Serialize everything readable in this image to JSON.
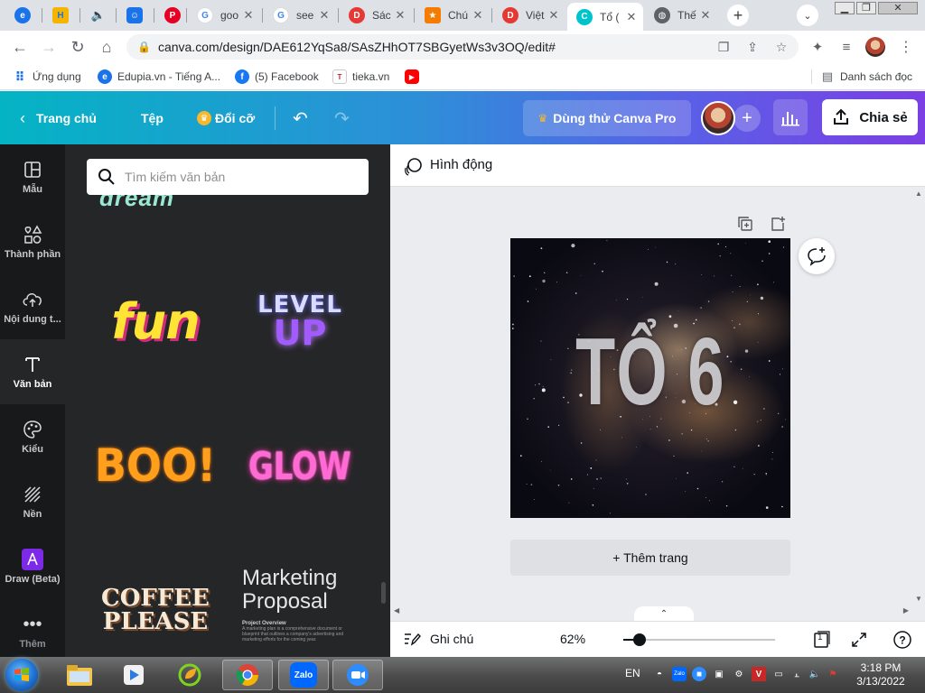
{
  "browser": {
    "tabs": [
      {
        "title": "",
        "favicon": "edupia-icon",
        "color": "#1a73e8"
      },
      {
        "title": "",
        "favicon": "yellow-h-icon",
        "color": "#f4b400"
      },
      {
        "title": "",
        "favicon": "speaker-icon",
        "color": "#5f6368"
      },
      {
        "title": "",
        "favicon": "bot-icon",
        "color": "#1a73e8"
      },
      {
        "title": "",
        "favicon": "pinterest-icon",
        "color": "#e60023"
      },
      {
        "title": "goo",
        "favicon": "google-icon",
        "color": "#4285f4"
      },
      {
        "title": "see",
        "favicon": "google-icon",
        "color": "#4285f4"
      },
      {
        "title": "Sác",
        "favicon": "d-logo-icon",
        "color": "#e53935"
      },
      {
        "title": "Chú",
        "favicon": "brand-icon",
        "color": "#f57c00"
      },
      {
        "title": "Việt",
        "favicon": "d-logo-icon",
        "color": "#e53935"
      },
      {
        "title": "Tổ (",
        "favicon": "canva-icon",
        "color": "#00c4cc"
      },
      {
        "title": "Thế",
        "favicon": "globe-icon",
        "color": "#5f6368"
      }
    ],
    "url": "canva.com/design/DAE612YqSa8/SAsZHhOT7SBGyetWs3v3OQ/edit#",
    "bookmarks": [
      {
        "label": "Ứng dụng",
        "icon": "apps-grid-icon"
      },
      {
        "label": "Edupia.vn - Tiếng A...",
        "icon": "edupia-icon"
      },
      {
        "label": "(5) Facebook",
        "icon": "facebook-icon"
      },
      {
        "label": "tieka.vn",
        "icon": "tieka-icon"
      },
      {
        "label": "",
        "icon": "youtube-icon"
      }
    ],
    "reading_list": "Danh sách đọc"
  },
  "canva_header": {
    "home": "Trang chủ",
    "file": "Tệp",
    "resize": "Đổi cỡ",
    "try_pro": "Dùng thử Canva Pro",
    "share": "Chia sẻ"
  },
  "rail": [
    {
      "label": "Mẫu",
      "icon": "template-icon"
    },
    {
      "label": "Thành phần",
      "icon": "elements-icon"
    },
    {
      "label": "Nội dung t...",
      "icon": "upload-cloud-icon"
    },
    {
      "label": "Văn bản",
      "icon": "text-icon",
      "active": true
    },
    {
      "label": "Kiểu",
      "icon": "palette-icon"
    },
    {
      "label": "Nền",
      "icon": "background-icon"
    },
    {
      "label": "Draw (Beta)",
      "icon": "draw-icon"
    },
    {
      "label": "Thêm",
      "icon": "more-dots-icon"
    }
  ],
  "panel": {
    "search_placeholder": "Tìm kiếm văn bản",
    "text_styles": [
      {
        "text": "fun",
        "name": "fun-text-style"
      },
      {
        "text": "LEVEL",
        "text2": "UP",
        "name": "level-up-text-style"
      },
      {
        "text": "BOO!",
        "name": "boo-text-style"
      },
      {
        "text": "GLOW",
        "name": "glow-text-style"
      },
      {
        "text": "COFFEE",
        "text2": "PLEASE",
        "name": "coffee-please-text-style"
      },
      {
        "text": "Marketing",
        "text2": "Proposal",
        "sub1": "Project Overview",
        "sub2": "A marketing plan is a comprehensive document or blueprint that outlines a company's advertising and marketing efforts for the coming year.",
        "name": "marketing-proposal-text-style"
      }
    ]
  },
  "canvas": {
    "animate_label": "Hình động",
    "page_title": "TỔ 6",
    "add_page": "+ Thêm trang"
  },
  "footer": {
    "notes": "Ghi chú",
    "zoom": "62%",
    "zoom_fraction": 0.11,
    "page_count": "1"
  },
  "taskbar": {
    "apps": [
      {
        "name": "explorer-icon"
      },
      {
        "name": "media-player-icon"
      },
      {
        "name": "leaf-app-icon"
      },
      {
        "name": "chrome-icon",
        "running": true
      },
      {
        "name": "zalo-icon",
        "label": "Zalo",
        "running": true
      },
      {
        "name": "zoom-icon",
        "running": true
      }
    ],
    "lang": "EN",
    "time": "3:18 PM",
    "date": "3/13/2022"
  },
  "colors": {
    "header_gradient_start": "#04b4c4",
    "header_gradient_end": "#7b3fe4",
    "rail_bg": "#18191b",
    "panel_bg": "#252627",
    "canvas_bg": "#ebecf0"
  }
}
